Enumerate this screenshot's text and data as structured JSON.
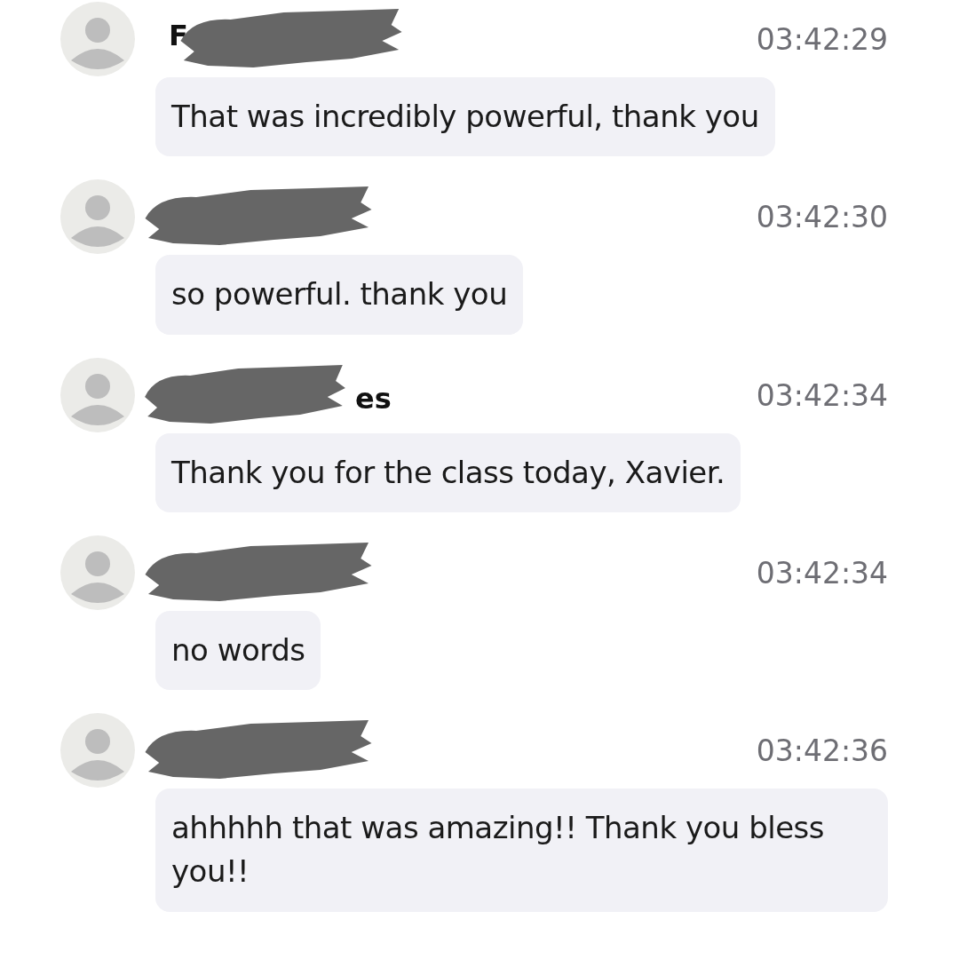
{
  "messages": [
    {
      "name": "F",
      "redacted": true,
      "time": "03:42:29",
      "text": "That was incredibly powerful, thank you"
    },
    {
      "redacted": true,
      "time": "03:42:30",
      "text": "so powerful. thank you"
    },
    {
      "name_end": "es",
      "redacted": true,
      "time": "03:42:34",
      "text": "Thank you for the class today, Xavier."
    },
    {
      "redacted": true,
      "time": "03:42:34",
      "text": "no words"
    },
    {
      "redacted": true,
      "time": "03:42:36",
      "text": "ahhhhh that was amazing!! Thank you bless you!!"
    }
  ]
}
